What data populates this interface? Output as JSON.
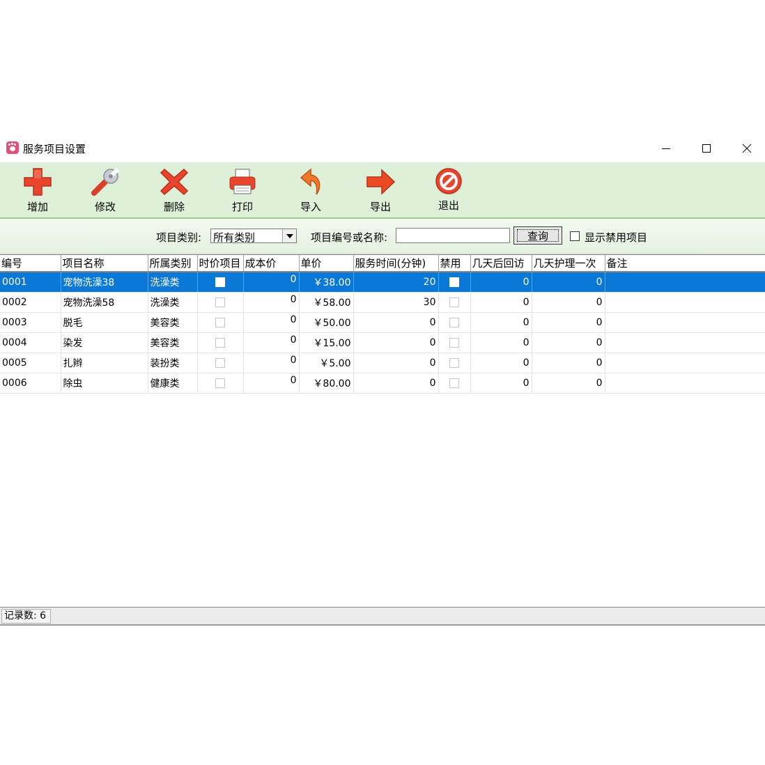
{
  "window": {
    "title": "服务项目设置"
  },
  "toolbar": {
    "add_label": "增加",
    "edit_label": "修改",
    "delete_label": "删除",
    "print_label": "打印",
    "import_label": "导入",
    "export_label": "导出",
    "exit_label": "退出"
  },
  "filter": {
    "category_label": "项目类别:",
    "category_value": "所有类别",
    "search_label": "项目编号或名称:",
    "search_value": "",
    "query_label": "查询",
    "show_disabled_label": "显示禁用项目",
    "show_disabled_checked": false
  },
  "table": {
    "columns": [
      "编号",
      "项目名称",
      "所属类别",
      "时价项目",
      "成本价",
      "单价",
      "服务时间(分钟)",
      "禁用",
      "几天后回访",
      "几天护理一次",
      "备注"
    ],
    "rows": [
      [
        "0001",
        "宠物洗澡38",
        "洗澡类",
        "",
        "0",
        "￥38.00",
        "20",
        "",
        "0",
        "0",
        ""
      ],
      [
        "0002",
        "宠物洗澡58",
        "洗澡类",
        "",
        "0",
        "￥58.00",
        "30",
        "",
        "0",
        "0",
        ""
      ],
      [
        "0003",
        "脱毛",
        "美容类",
        "",
        "0",
        "￥50.00",
        "0",
        "",
        "0",
        "0",
        ""
      ],
      [
        "0004",
        "染发",
        "美容类",
        "",
        "0",
        "￥15.00",
        "0",
        "",
        "0",
        "0",
        ""
      ],
      [
        "0005",
        "扎辫",
        "装扮类",
        "",
        "0",
        "￥5.00",
        "0",
        "",
        "0",
        "0",
        ""
      ],
      [
        "0006",
        "除虫",
        "健康类",
        "",
        "0",
        "￥80.00",
        "0",
        "",
        "0",
        "0",
        ""
      ]
    ],
    "selected_row": 0
  },
  "status": {
    "record_count": "记录数: 6"
  },
  "colors": {
    "toolbar_bg": "#dff0d8",
    "selection": "#0a78d7",
    "icon_red": "#e8452c"
  },
  "icons": [
    "add-icon",
    "wrench-icon",
    "delete-icon",
    "printer-icon",
    "import-arrow-icon",
    "export-arrow-icon",
    "exit-icon"
  ]
}
